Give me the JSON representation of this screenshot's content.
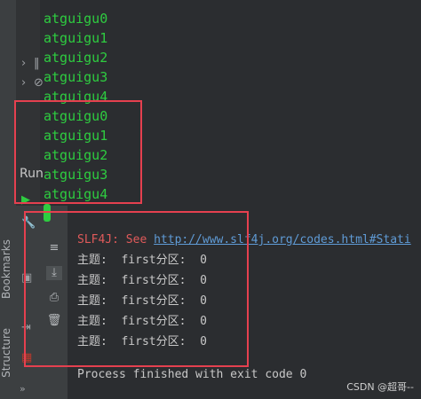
{
  "top_output": [
    "atguigu0",
    "atguigu1",
    "atguigu2",
    "atguigu3",
    "atguigu4",
    "atguigu0",
    "atguigu1",
    "atguigu2",
    "atguigu3",
    "atguigu4"
  ],
  "run_label": "Run",
  "sidebar": {
    "bookmarks": "Bookmarks",
    "structure": "Structure"
  },
  "console": {
    "slf4j_prefix": "SLF4J: See ",
    "slf4j_link": "http://www.slf4j.org/codes.html#Stati",
    "messages": [
      "主题:  first分区:  0",
      "主题:  first分区:  0",
      "主题:  first分区:  0",
      "主题:  first分区:  0",
      "主题:  first分区:  0"
    ],
    "exit": "Process finished with exit code 0"
  },
  "watermark": "CSDN @超哥--",
  "colors": {
    "output_green": "#2ecc40",
    "highlight_red": "#e5404f",
    "slf4j_red": "#e05a5a",
    "link_blue": "#5f9bd6"
  }
}
